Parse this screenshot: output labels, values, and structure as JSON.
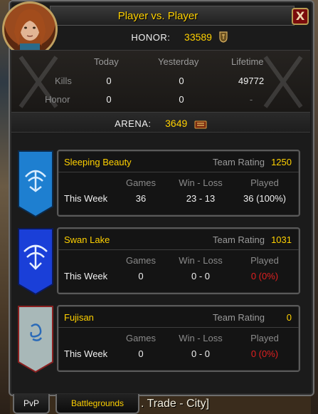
{
  "window": {
    "title": "Player vs. Player",
    "close_label": "X"
  },
  "honor": {
    "label": "HONOR:",
    "value": "33589"
  },
  "stats": {
    "columns": [
      "Today",
      "Yesterday",
      "Lifetime"
    ],
    "rows": [
      {
        "label": "Kills",
        "values": [
          "0",
          "0",
          "49772"
        ]
      },
      {
        "label": "Honor",
        "values": [
          "0",
          "0",
          "-"
        ]
      }
    ]
  },
  "arena": {
    "label": "ARENA:",
    "value": "3649"
  },
  "team_labels": {
    "rating": "Team Rating",
    "games": "Games",
    "win_loss": "Win - Loss",
    "played": "Played",
    "this_week": "This Week"
  },
  "teams": [
    {
      "name": "Sleeping Beauty",
      "rating": "1250",
      "games": "36",
      "win_loss": "23 - 13",
      "played": "36 (100%)",
      "banner_color": "#1e7fd0",
      "emblem_color": "#d8ecff"
    },
    {
      "name": "Swan Lake",
      "rating": "1031",
      "games": "0",
      "win_loss": "0 - 0",
      "played": "0 (0%)",
      "banner_color": "#1a3fd8",
      "emblem_color": "#e8f0ff"
    },
    {
      "name": "Fujisan",
      "rating": "0",
      "games": "0",
      "win_loss": "0 - 0",
      "played": "0 (0%)",
      "banner_color": "#a8b8b8",
      "emblem_color": "#2a6ab8"
    }
  ],
  "tabs": [
    {
      "label": "PvP"
    },
    {
      "label": "Battlegrounds"
    }
  ],
  "chat": {
    "fragment": ". Trade - City]"
  },
  "colors": {
    "gold": "#ffd100",
    "red": "#e02020",
    "frame": "#1b1b1b"
  }
}
